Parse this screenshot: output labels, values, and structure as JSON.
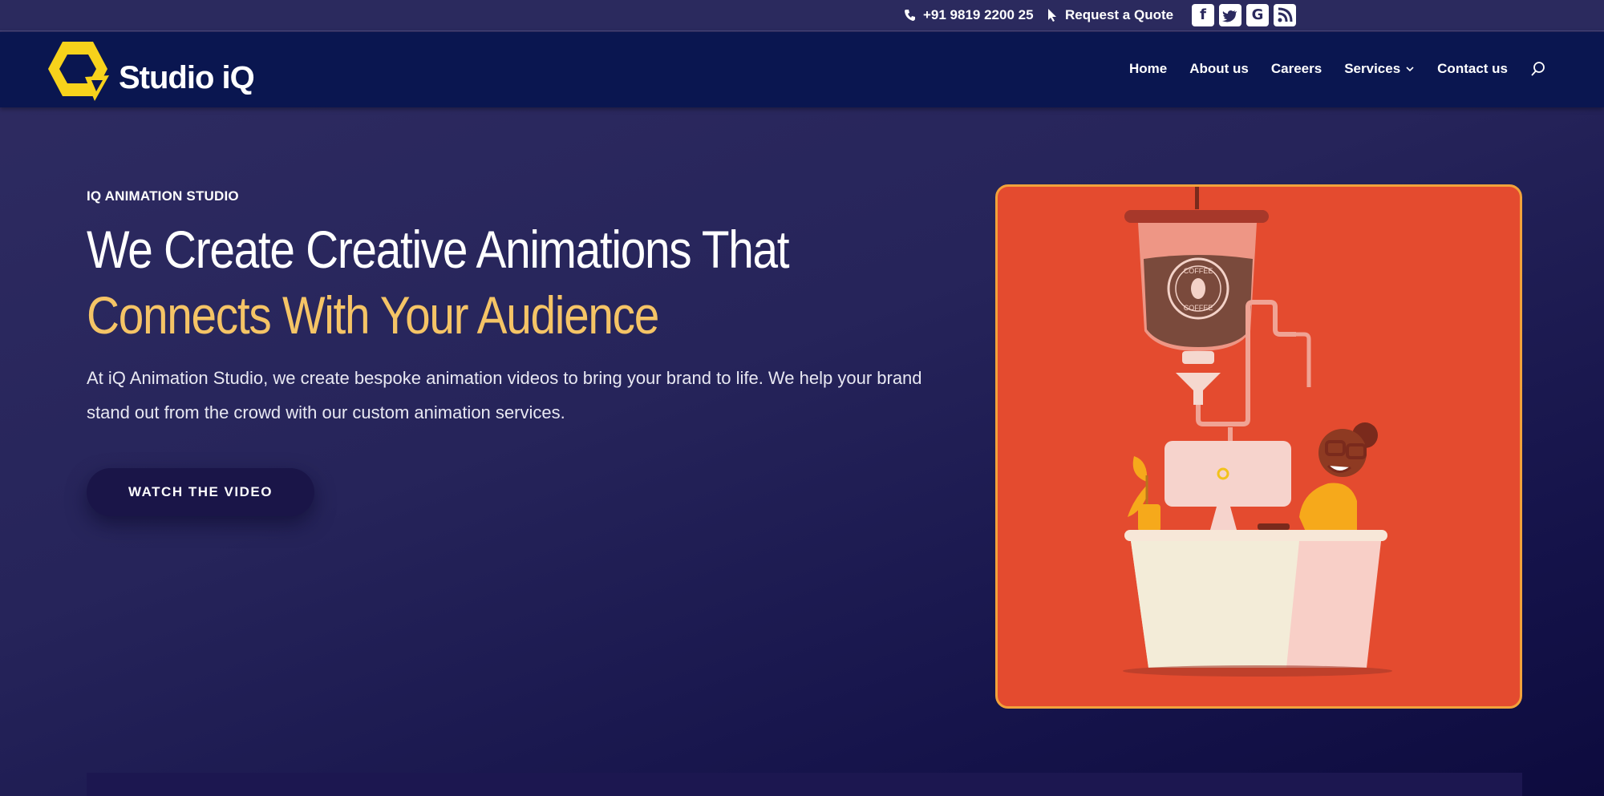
{
  "topbar": {
    "phone": "+91 9819 2200 25",
    "quote": "Request a Quote",
    "socials": [
      {
        "icon": "facebook-icon",
        "glyph": "f"
      },
      {
        "icon": "twitter-icon",
        "glyph": "t"
      },
      {
        "icon": "google-plus-icon",
        "glyph": "G"
      },
      {
        "icon": "rss-icon",
        "glyph": ")"
      }
    ]
  },
  "header": {
    "brand": "Studio iQ",
    "nav": [
      "Home",
      "About us",
      "Careers",
      "Services",
      "Contact us"
    ]
  },
  "hero": {
    "eyebrow": "IQ ANIMATION STUDIO",
    "headline_white": "We Create Creative Animations That ",
    "headline_gold": "Connects With Your Audience",
    "description": "At iQ Animation Studio, we create bespoke animation videos to bring your brand to life. We help your brand stand out from the crowd with our custom animation services.",
    "cta": "WATCH THE VIDEO"
  },
  "illustration": {
    "jar_label_top": "COFFEE",
    "jar_label_bottom": "COFFEE"
  },
  "colors": {
    "accent_gold": "#f5c466",
    "card_red": "#e44b2f",
    "header_navy": "#0a1650"
  }
}
